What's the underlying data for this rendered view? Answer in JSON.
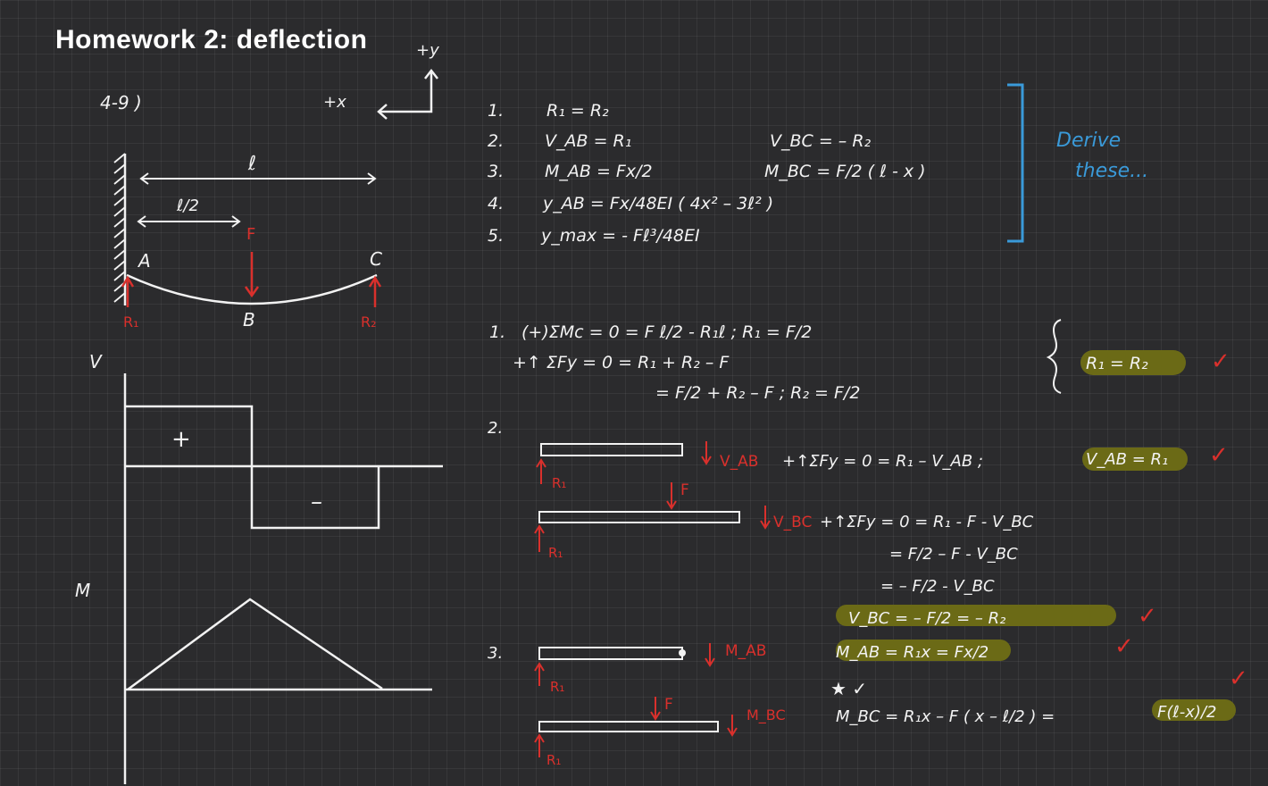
{
  "title": "Homework 2: deflection",
  "colors": {
    "background": "#2b2b2d",
    "ink": "#f2f2f2",
    "red": "#d9302c",
    "blue": "#3a9ad9",
    "highlight": "#6b6a16"
  },
  "axes": {
    "y": "+y",
    "x": "+x"
  },
  "problem_label": "4-9 )",
  "beam": {
    "length_label": "ℓ",
    "half_label": "ℓ/2",
    "force": "F",
    "point_a": "A",
    "point_b": "B",
    "point_c": "C",
    "r1": "R₁",
    "r2": "R₂"
  },
  "shear_diagram": {
    "label": "V",
    "plus": "+",
    "minus": "–"
  },
  "moment_diagram": {
    "label": "M"
  },
  "formulas": [
    {
      "n": "1.",
      "left": "R₁ = R₂",
      "right": ""
    },
    {
      "n": "2.",
      "left": "V_AB = R₁",
      "right": "V_BC = – R₂"
    },
    {
      "n": "3.",
      "left": "M_AB = Fx/2",
      "right": "M_BC = F/2 ( ℓ - x )"
    },
    {
      "n": "4.",
      "left": "y_AB = Fx/48EI ( 4x² – 3ℓ² )",
      "right": ""
    },
    {
      "n": "5.",
      "left": "y_max = - Fℓ³/48EI",
      "right": ""
    }
  ],
  "derive_note": [
    "Derive",
    "these..."
  ],
  "step1": {
    "n": "1.",
    "lines": [
      "(+)ΣMc = 0 = F ℓ/2 - R₁ℓ ;   R₁ = F/2",
      "+↑ ΣFy = 0 = R₁ + R₂ – F",
      "= F/2 + R₂ – F ;   R₂ = F/2"
    ],
    "result": "R₁ = R₂",
    "check": "✓"
  },
  "step2": {
    "n": "2.",
    "fbd1": {
      "r": "R₁",
      "v": "V_AB"
    },
    "eq1": "+↑ΣFy = 0 = R₁ – V_AB ;",
    "result1": "V_AB = R₁",
    "fbd2": {
      "r": "R₁",
      "f": "F",
      "v": "V_BC"
    },
    "eq2": [
      "+↑ΣFy = 0 = R₁ - F - V_BC",
      "= F/2 – F - V_BC",
      "= – F/2 - V_BC"
    ],
    "result2": "V_BC = – F/2 = – R₂",
    "check": "✓"
  },
  "step3": {
    "n": "3.",
    "fbd1": {
      "r": "R₁",
      "m": "M_AB"
    },
    "result1": "M_AB = R₁x = Fx/2",
    "fbd2": {
      "r": "R₁",
      "f": "F",
      "m": "M_BC"
    },
    "eq2": "M_BC = R₁x – F ( x – ℓ/2 ) =",
    "result2": "F(ℓ-x)/2",
    "star": "★ ✓",
    "check": "✓"
  }
}
